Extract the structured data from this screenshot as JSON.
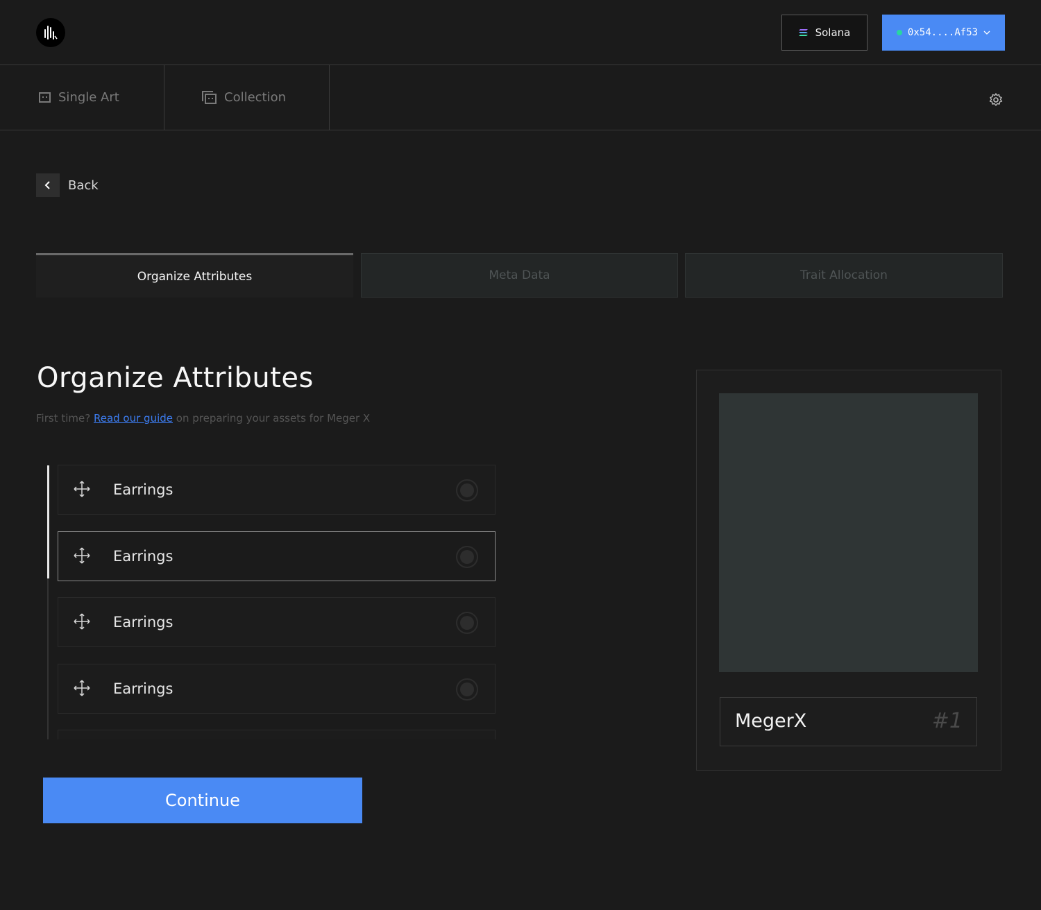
{
  "header": {
    "network_label": "Solana",
    "wallet_label": "0x54....Af53"
  },
  "mode_tabs": [
    {
      "label": "Single Art"
    },
    {
      "label": "Collection"
    }
  ],
  "back_label": "Back",
  "steps": [
    {
      "label": "Organize Attributes",
      "active": true
    },
    {
      "label": "Meta Data",
      "active": false
    },
    {
      "label": "Trait Allocation",
      "active": false
    }
  ],
  "main": {
    "title": "Organize Attributes",
    "subtitle_prefix": "First time?",
    "subtitle_link": "Read our guide",
    "subtitle_suffix": "on preparing your assets for Meger X"
  },
  "attributes": [
    {
      "label": "Earrings",
      "selected": false
    },
    {
      "label": "Earrings",
      "selected": true
    },
    {
      "label": "Earrings",
      "selected": false
    },
    {
      "label": "Earrings",
      "selected": false
    }
  ],
  "continue_label": "Continue",
  "preview": {
    "name": "MegerX",
    "number": "#1"
  },
  "colors": {
    "accent": "#4a8af4",
    "background": "#1b1b1b",
    "status_dot": "#27d7a0"
  }
}
